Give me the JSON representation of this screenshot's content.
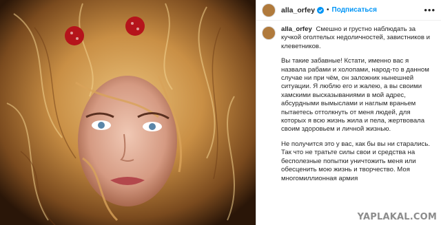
{
  "post": {
    "username": "alla_orfey",
    "follow_label": "Подписаться",
    "separator": "•",
    "more_label": "•••",
    "caption": {
      "username": "alla_orfey",
      "p1": "Смешно и грустно наблюдать за кучкой оголтелых недоличностей, завистников и клеветников.",
      "p2": "Вы такие забавные! Кстати, именно вас я назвала рабами и холопами, народ-то в данном случае ни при чём, он заложник нынешней ситуации. Я люблю его и жалею, а вы своими хамскими высказываниями в мой адрес, абсурдными вымыслами и наглым враньем пытаетесь оттолкнуть от меня людей, для которых я всю жизнь жила и пела, жертвовала своим здоровьем и личной жизнью.",
      "p3": "Не получится это у вас, как бы вы ни старались. Так что не тратьте силы свои и средства на бесполезные попытки уничтожить меня или обесценить мою жизнь и творчество. Моя многомиллионная армия"
    },
    "watermark": "YAPLAKAL.COM",
    "colors": {
      "accent": "#0095f6",
      "text": "#262626",
      "border": "#dbdbdb"
    },
    "icons": {
      "verified": "verified-badge-icon",
      "more": "more-options-icon"
    }
  }
}
